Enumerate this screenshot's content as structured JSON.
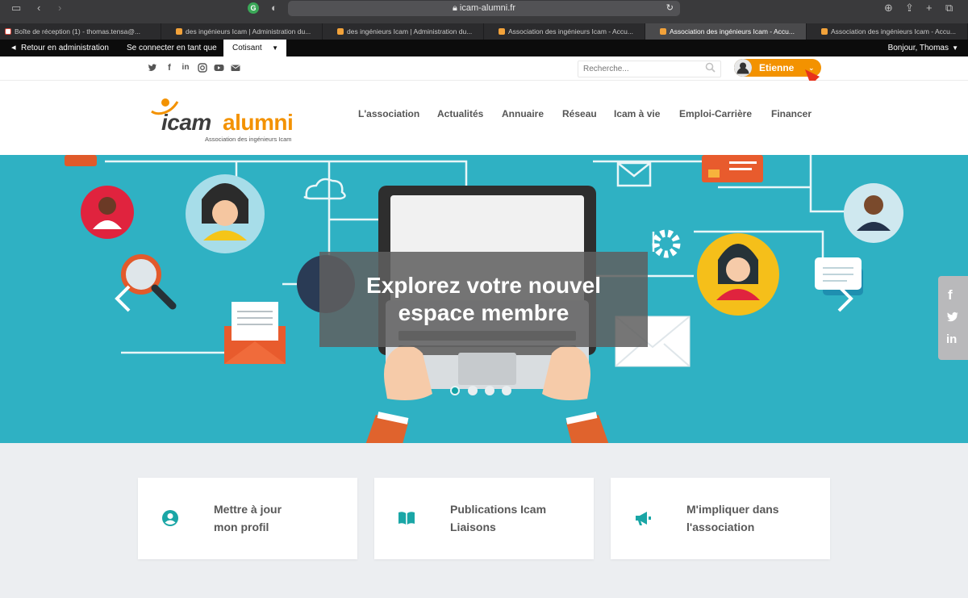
{
  "browser": {
    "url": "icam-alumni.fr",
    "tabs": [
      {
        "title": "Boîte de réception (1) - thomas.tensa@...",
        "active": false,
        "favicon": "gmail-icon"
      },
      {
        "title": "des ingénieurs Icam | Administration du...",
        "active": false,
        "favicon": "icam-icon"
      },
      {
        "title": "des ingénieurs Icam | Administration du...",
        "active": false,
        "favicon": "icam-icon"
      },
      {
        "title": "Association des ingénieurs Icam - Accu...",
        "active": false,
        "favicon": "icam-icon"
      },
      {
        "title": "Association des ingénieurs Icam - Accu...",
        "active": true,
        "favicon": "icam-icon"
      },
      {
        "title": "Association des ingénieurs Icam - Accu...",
        "active": false,
        "favicon": "icam-icon"
      }
    ]
  },
  "adminbar": {
    "back_label": "Retour en administration",
    "connect_as_label": "Se connecter en tant que",
    "role_select_value": "Cotisant",
    "greeting": "Bonjour, Thomas"
  },
  "topbar": {
    "social_icons": [
      "twitter-icon",
      "facebook-icon",
      "linkedin-icon",
      "instagram-icon",
      "youtube-icon",
      "email-icon"
    ],
    "search_placeholder": "Recherche...",
    "user_name": "Etienne"
  },
  "logo": {
    "word1": "icam",
    "word2": "alumni",
    "tagline": "Association des ingénieurs Icam"
  },
  "nav": [
    "L'association",
    "Actualités",
    "Annuaire",
    "Réseau",
    "Icam à vie",
    "Emploi-Carrière",
    "Financer"
  ],
  "hero": {
    "caption_line1": "Explorez votre nouvel",
    "caption_line2": "espace membre",
    "slide_count": 4,
    "active_slide": 1
  },
  "cards": [
    {
      "line1": "Mettre à jour",
      "line2": "mon profil",
      "icon": "user-circle-icon"
    },
    {
      "line1": "Publications Icam",
      "line2": "Liaisons",
      "icon": "open-book-icon"
    },
    {
      "line1": "M'impliquer dans",
      "line2": "l'association",
      "icon": "megaphone-icon"
    }
  ],
  "colors": {
    "accent": "#f39200",
    "teal": "#2fb1c3",
    "icon_teal": "#1aa6a6",
    "admin_bar": "#0c0c0c"
  }
}
